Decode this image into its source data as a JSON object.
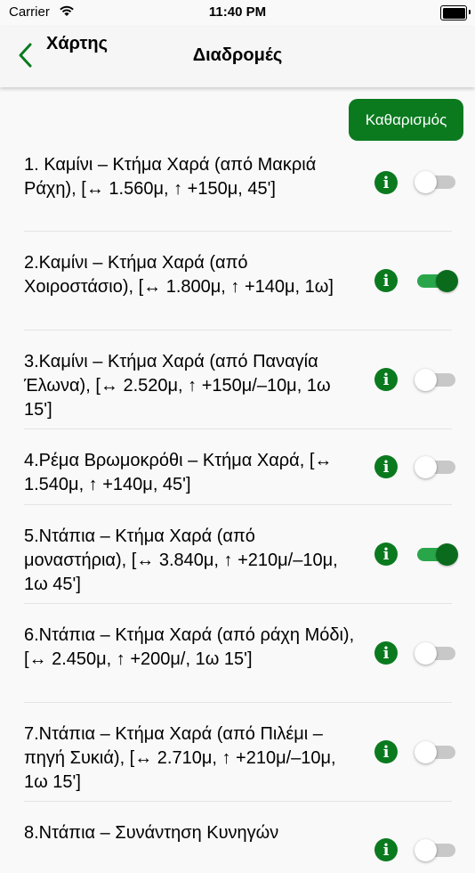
{
  "status_bar": {
    "carrier": "Carrier",
    "time": "11:40 PM"
  },
  "nav": {
    "back_label": "Χάρτης",
    "title": "Διαδρομές"
  },
  "clear_button": "Καθαρισμός",
  "colors": {
    "accent": "#0b7a1f",
    "toggle_on_track": "#2aa64a",
    "toggle_off_track": "#c8c8c8"
  },
  "routes": [
    {
      "label": "1. Καμίνι – Κτήμα Χαρά (από Μακριά Ράχη), [↔ 1.560μ, ↑ +150μ, 45']",
      "enabled": false
    },
    {
      "label": "2.Καμίνι – Κτήμα Χαρά (από Χοιροστάσιο), [↔ 1.800μ, ↑ +140μ, 1ω]",
      "enabled": true
    },
    {
      "label": "3.Καμίνι – Κτήμα Χαρά (από Παναγία Έλωνα), [↔ 2.520μ, ↑ +150μ/–10μ, 1ω 15']",
      "enabled": false
    },
    {
      "label": "4.Ρέμα Βρωμοκρόθι – Κτήμα Χαρά, [↔ 1.540μ, ↑ +140μ, 45']",
      "enabled": false
    },
    {
      "label": "5.Ντάπια – Κτήμα Χαρά (από μοναστήρια), [↔ 3.840μ, ↑ +210μ/–10μ, 1ω 45']",
      "enabled": true
    },
    {
      "label": "6.Ντάπια – Κτήμα Χαρά (από ράχη Μόδι), [↔ 2.450μ, ↑ +200μ/, 1ω 15']",
      "enabled": false
    },
    {
      "label": "7.Ντάπια – Κτήμα Χαρά (από Πιλέμι – πηγή Συκιά), [↔ 2.710μ, ↑ +210μ/–10μ, 1ω 15']",
      "enabled": false
    },
    {
      "label": "8.Ντάπια – Συνάντηση Κυνηγών",
      "enabled": false
    }
  ]
}
